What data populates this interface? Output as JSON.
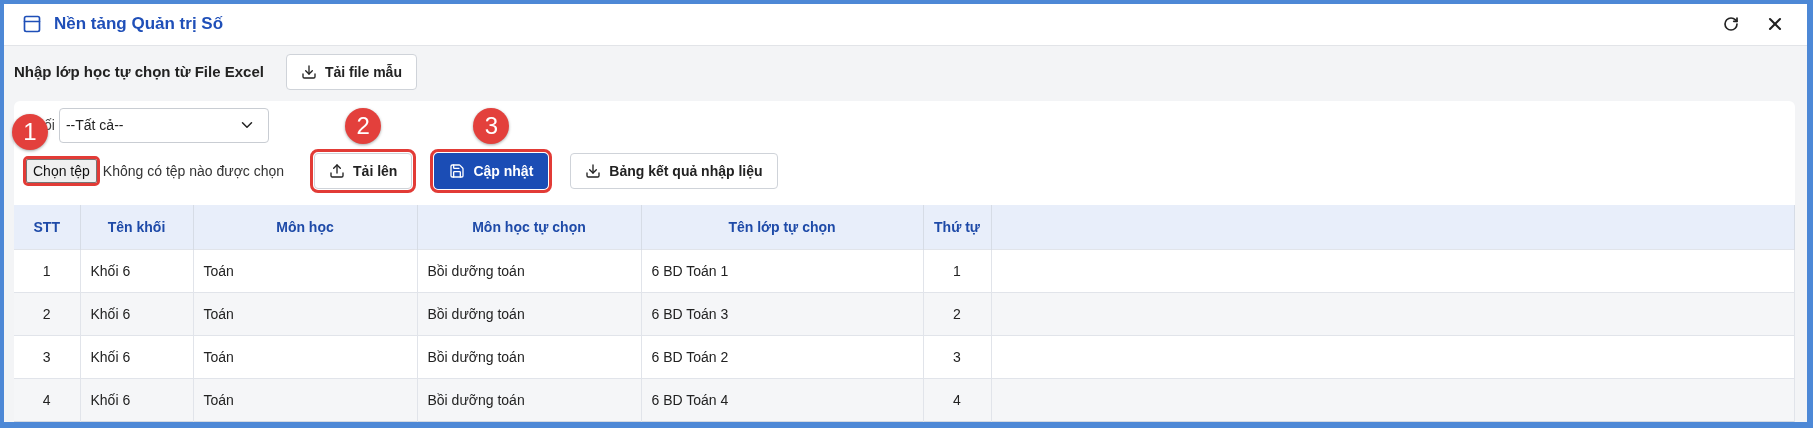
{
  "window": {
    "title": "Nền tảng Quản trị Số"
  },
  "import_header": {
    "label": "Nhập lớp học tự chọn từ File Excel",
    "button": {
      "label": "Tải file mẫu",
      "kind": "download"
    }
  },
  "filter": {
    "label": "ối",
    "value": "--Tất cả--"
  },
  "file_input": {
    "button": "Chọn tệp",
    "status": "Không có tệp nào được chọn",
    "highlighted": true,
    "badge": "1"
  },
  "actions": [
    {
      "label": "Tải lên",
      "kind": "upload",
      "primary": false,
      "highlighted": true,
      "badge": "2"
    },
    {
      "label": "Cập nhật",
      "kind": "save",
      "primary": true,
      "highlighted": true,
      "badge": "3"
    },
    {
      "label": "Bảng kết quả nhập liệu",
      "kind": "download",
      "primary": false,
      "highlighted": false
    }
  ],
  "table": {
    "columns": [
      "STT",
      "Tên khối",
      "Môn học",
      "Môn học tự chọn",
      "Tên lớp tự chọn",
      "Thứ tự"
    ],
    "rows": [
      [
        "1",
        "Khối 6",
        "Toán",
        "Bồi dưỡng toán",
        "6 BD Toán 1",
        "1"
      ],
      [
        "2",
        "Khối 6",
        "Toán",
        "Bồi dưỡng toán",
        "6 BD Toán 3",
        "2"
      ],
      [
        "3",
        "Khối 6",
        "Toán",
        "Bồi dưỡng toán",
        "6 BD Toán 2",
        "3"
      ],
      [
        "4",
        "Khối 6",
        "Toán",
        "Bồi dưỡng toán",
        "6 BD Toán 4",
        "4"
      ]
    ]
  }
}
